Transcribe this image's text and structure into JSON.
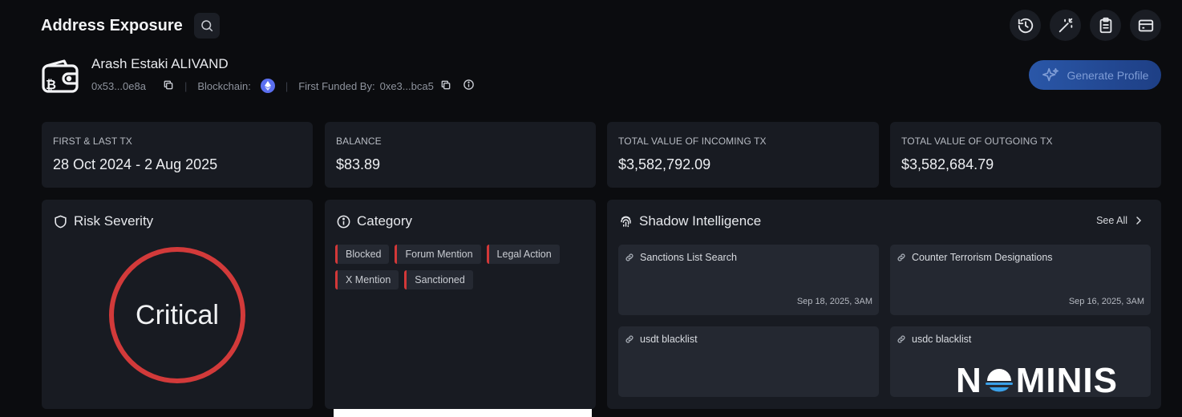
{
  "header": {
    "title": "Address Exposure"
  },
  "profile": {
    "name": "Arash Estaki ALIVAND",
    "address": "0x53...0e8a",
    "blockchain_label": "Blockchain:",
    "first_funded_label": "First Funded By:",
    "first_funded_value": "0xe3...bca5"
  },
  "actions": {
    "generate_profile": "Generate Profile"
  },
  "stats": [
    {
      "label": "FIRST & LAST TX",
      "value": "28 Oct 2024 - 2 Aug 2025"
    },
    {
      "label": "BALANCE",
      "value": "$83.89"
    },
    {
      "label": "TOTAL VALUE OF INCOMING TX",
      "value": "$3,582,792.09"
    },
    {
      "label": "TOTAL VALUE OF OUTGOING TX",
      "value": "$3,582,684.79"
    }
  ],
  "risk": {
    "title": "Risk Severity",
    "level": "Critical",
    "color": "#d23a3a"
  },
  "category": {
    "title": "Category",
    "tags": [
      "Blocked",
      "Forum Mention",
      "Legal Action",
      "X Mention",
      "Sanctioned"
    ]
  },
  "intel": {
    "title": "Shadow Intelligence",
    "see_all": "See All",
    "cards": [
      {
        "title": "Sanctions List Search",
        "date": "Sep 18, 2025, 3AM"
      },
      {
        "title": "Counter Terrorism Designations",
        "date": "Sep 16, 2025, 3AM"
      },
      {
        "title": "usdt blacklist",
        "date": ""
      },
      {
        "title": "usdc blacklist",
        "date": ""
      }
    ]
  },
  "watermark": {
    "left": "N",
    "right": "MINIS"
  },
  "colors": {
    "accent_red": "#d33838",
    "panel": "#181b22",
    "background": "#0b0c0f",
    "button_blue": "#2a57a8"
  }
}
